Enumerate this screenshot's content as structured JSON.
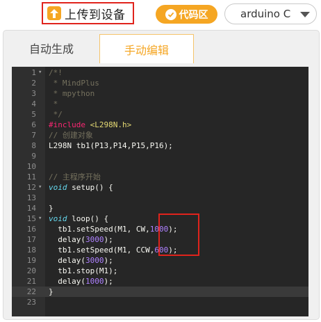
{
  "toolbar": {
    "upload_label": "上传到设备",
    "upload_icon": "upload-arrow-icon",
    "code_area_label": "代码区",
    "code_area_icon": "checkmark-icon",
    "board_select_value": "arduino C",
    "accent_color": "#f5a623",
    "highlight_color": "#e0231c"
  },
  "tabs": [
    {
      "label": "自动生成",
      "active": false
    },
    {
      "label": "手动编辑",
      "active": true
    }
  ],
  "code": {
    "lines": [
      {
        "n": "1",
        "fold": "▾",
        "parts": [
          {
            "t": "/*!",
            "c": "t-comment"
          }
        ]
      },
      {
        "n": "2",
        "fold": "",
        "parts": [
          {
            "t": " * MindPlus",
            "c": "t-comment"
          }
        ]
      },
      {
        "n": "3",
        "fold": "",
        "parts": [
          {
            "t": " * mpython",
            "c": "t-comment"
          }
        ]
      },
      {
        "n": "4",
        "fold": "",
        "parts": [
          {
            "t": " *",
            "c": "t-comment"
          }
        ]
      },
      {
        "n": "5",
        "fold": "",
        "parts": [
          {
            "t": " */",
            "c": "t-comment"
          }
        ]
      },
      {
        "n": "6",
        "fold": "",
        "parts": [
          {
            "t": "#include ",
            "c": "t-pre"
          },
          {
            "t": "<L298N.h>",
            "c": "t-inc"
          }
        ]
      },
      {
        "n": "7",
        "fold": "",
        "parts": [
          {
            "t": "// 创建对象",
            "c": "t-comment"
          }
        ]
      },
      {
        "n": "8",
        "fold": "",
        "parts": [
          {
            "t": "L298N tb1(P13,P14,P15,P16);",
            "c": ""
          }
        ]
      },
      {
        "n": "9",
        "fold": "",
        "parts": []
      },
      {
        "n": "10",
        "fold": "",
        "parts": []
      },
      {
        "n": "11",
        "fold": "",
        "parts": [
          {
            "t": "// 主程序开始",
            "c": "t-comment"
          }
        ]
      },
      {
        "n": "12",
        "fold": "▾",
        "parts": [
          {
            "t": "void",
            "c": "t-kw"
          },
          {
            "t": " setup() {",
            "c": ""
          }
        ]
      },
      {
        "n": "13",
        "fold": "",
        "parts": []
      },
      {
        "n": "14",
        "fold": "",
        "parts": [
          {
            "t": "}",
            "c": ""
          }
        ]
      },
      {
        "n": "15",
        "fold": "▾",
        "parts": [
          {
            "t": "void",
            "c": "t-kw"
          },
          {
            "t": " loop() {",
            "c": ""
          }
        ]
      },
      {
        "n": "16",
        "fold": "",
        "parts": [
          {
            "t": "  tb1.setSpeed(M1, CW,",
            "c": ""
          },
          {
            "t": "1000",
            "c": "t-num"
          },
          {
            "t": ");",
            "c": ""
          }
        ]
      },
      {
        "n": "17",
        "fold": "",
        "parts": [
          {
            "t": "  delay(",
            "c": ""
          },
          {
            "t": "3000",
            "c": "t-num"
          },
          {
            "t": ");",
            "c": ""
          }
        ]
      },
      {
        "n": "18",
        "fold": "",
        "parts": [
          {
            "t": "  tb1.setSpeed(M1, CCW,",
            "c": ""
          },
          {
            "t": "600",
            "c": "t-num"
          },
          {
            "t": ");",
            "c": ""
          }
        ]
      },
      {
        "n": "19",
        "fold": "",
        "parts": [
          {
            "t": "  delay(",
            "c": ""
          },
          {
            "t": "3000",
            "c": "t-num"
          },
          {
            "t": ");",
            "c": ""
          }
        ]
      },
      {
        "n": "20",
        "fold": "",
        "parts": [
          {
            "t": "  tb1.stop(M1);",
            "c": ""
          }
        ]
      },
      {
        "n": "21",
        "fold": "",
        "parts": [
          {
            "t": "  delay(",
            "c": ""
          },
          {
            "t": "1000",
            "c": "t-num"
          },
          {
            "t": ");",
            "c": ""
          }
        ]
      },
      {
        "n": "22",
        "fold": "",
        "parts": [
          {
            "t": "}",
            "c": ""
          }
        ],
        "active": true
      },
      {
        "n": "23",
        "fold": "",
        "parts": []
      }
    ]
  }
}
